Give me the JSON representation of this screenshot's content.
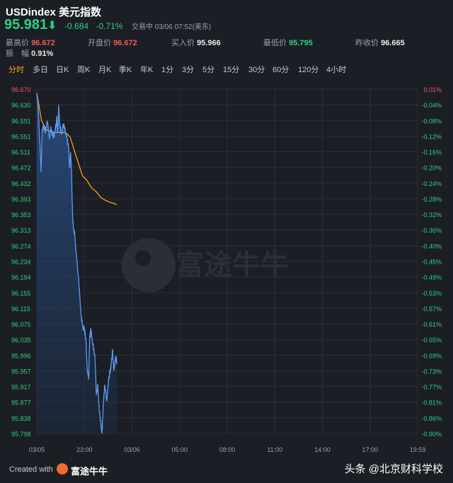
{
  "header": {
    "title": "USDindex 美元指数",
    "price": "95.981",
    "change": "-0.684",
    "change_pct": "-0.71%",
    "status": "交易中 03/06 07:52(美东)"
  },
  "stats": [
    {
      "label": "最高价",
      "value": "96.672",
      "color": "red"
    },
    {
      "label": "开盘价",
      "value": "96.672",
      "color": "red"
    },
    {
      "label": "买入价",
      "value": "95.966",
      "color": "white"
    },
    {
      "label": "最低价",
      "value": "95.795",
      "color": "green"
    },
    {
      "label": "昨收价",
      "value": "96.665",
      "color": "white"
    },
    {
      "label": "振　幅",
      "value": "0.91%",
      "color": "white"
    }
  ],
  "tabs": [
    "分时",
    "多日",
    "日K",
    "周K",
    "月K",
    "季K",
    "年K",
    "1分",
    "3分",
    "5分",
    "15分",
    "30分",
    "60分",
    "120分",
    "4小时"
  ],
  "active_tab": "分时",
  "watermark": "富途牛牛",
  "footer": {
    "created_with": "Created with",
    "brand": "富途牛牛",
    "source": "头条 @北京财科学校"
  },
  "colors": {
    "up": "#f05a5a",
    "down": "#2fd07e",
    "price_line": "#5a9cf5",
    "avg_line": "#f7a21b",
    "bg": "#1b1e25",
    "accent": "#ff9e1f"
  },
  "chart_data": {
    "type": "line",
    "y_ticks": [
      "96.670",
      "96.630",
      "96.591",
      "96.551",
      "96.511",
      "96.472",
      "96.432",
      "96.393",
      "96.353",
      "96.313",
      "96.274",
      "96.234",
      "96.194",
      "96.155",
      "96.115",
      "96.075",
      "96.035",
      "95.996",
      "95.957",
      "95.917",
      "95.877",
      "95.838",
      "95.798"
    ],
    "pct_ticks": [
      "0.01%",
      "-0.04%",
      "-0.08%",
      "-0.12%",
      "-0.16%",
      "-0.20%",
      "-0.24%",
      "-0.28%",
      "-0.32%",
      "-0.36%",
      "-0.40%",
      "-0.45%",
      "-0.49%",
      "-0.53%",
      "-0.57%",
      "-0.61%",
      "-0.65%",
      "-0.69%",
      "-0.73%",
      "-0.77%",
      "-0.81%",
      "-0.86%",
      "-0.90%"
    ],
    "x_ticks": [
      "03/05",
      "23:00",
      "03/06",
      "05:00",
      "08:00",
      "11:00",
      "14:00",
      "17:00",
      "19:59"
    ],
    "ylim": [
      95.798,
      96.67
    ],
    "series": [
      {
        "points": [
          [
            0,
            96.66
          ],
          [
            0.02,
            96.64
          ],
          [
            0.04,
            96.6
          ],
          [
            0.07,
            96.52
          ],
          [
            0.09,
            96.46
          ],
          [
            0.11,
            96.56
          ],
          [
            0.14,
            96.58
          ],
          [
            0.18,
            96.56
          ],
          [
            0.22,
            96.59
          ],
          [
            0.26,
            96.55
          ],
          [
            0.3,
            96.57
          ],
          [
            0.34,
            96.55
          ],
          [
            0.38,
            96.56
          ],
          [
            0.42,
            96.6
          ],
          [
            0.44,
            96.56
          ],
          [
            0.46,
            96.63
          ],
          [
            0.48,
            96.58
          ],
          [
            0.52,
            96.56
          ],
          [
            0.56,
            96.58
          ],
          [
            0.6,
            96.56
          ],
          [
            0.64,
            96.54
          ],
          [
            0.67,
            96.52
          ],
          [
            0.69,
            96.47
          ],
          [
            0.71,
            96.51
          ],
          [
            0.73,
            96.46
          ],
          [
            0.74,
            96.4
          ],
          [
            0.76,
            96.33
          ],
          [
            0.8,
            96.3
          ],
          [
            0.83,
            96.25
          ],
          [
            0.87,
            96.2
          ],
          [
            0.9,
            96.15
          ],
          [
            0.93,
            96.1
          ],
          [
            0.96,
            96.07
          ],
          [
            1.0,
            96.06
          ],
          [
            1.03,
            96.04
          ],
          [
            1.06,
            95.96
          ],
          [
            1.09,
            95.94
          ],
          [
            1.11,
            96.04
          ],
          [
            1.14,
            96.06
          ],
          [
            1.18,
            96.02
          ],
          [
            1.22,
            96.0
          ],
          [
            1.25,
            95.9
          ],
          [
            1.28,
            95.92
          ],
          [
            1.31,
            95.86
          ],
          [
            1.34,
            95.83
          ],
          [
            1.37,
            95.8
          ],
          [
            1.4,
            95.88
          ],
          [
            1.43,
            95.92
          ],
          [
            1.47,
            95.88
          ],
          [
            1.51,
            95.94
          ],
          [
            1.55,
            95.96
          ],
          [
            1.59,
            96.01
          ],
          [
            1.62,
            95.96
          ],
          [
            1.65,
            95.99
          ],
          [
            1.68,
            95.981
          ]
        ]
      },
      {
        "points": [
          [
            0,
            96.66
          ],
          [
            0.1,
            96.59
          ],
          [
            0.2,
            96.567
          ],
          [
            0.35,
            96.56
          ],
          [
            0.5,
            96.56
          ],
          [
            0.6,
            96.56
          ],
          [
            0.65,
            96.555
          ],
          [
            0.7,
            96.548
          ],
          [
            0.75,
            96.53
          ],
          [
            0.8,
            96.51
          ],
          [
            0.88,
            96.48
          ],
          [
            0.96,
            96.45
          ],
          [
            1.05,
            96.44
          ],
          [
            1.15,
            96.42
          ],
          [
            1.25,
            96.41
          ],
          [
            1.35,
            96.395
          ],
          [
            1.45,
            96.388
          ],
          [
            1.55,
            96.383
          ],
          [
            1.65,
            96.379
          ],
          [
            1.68,
            96.378
          ]
        ]
      }
    ]
  }
}
